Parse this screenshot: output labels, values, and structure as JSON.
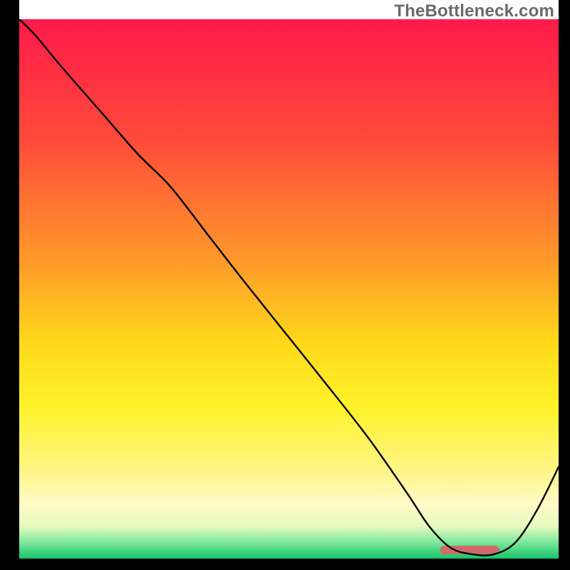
{
  "watermark_text": "TheBottleneck.com",
  "chart_data": {
    "type": "line",
    "title": "",
    "xlabel": "",
    "ylabel": "",
    "xlim": [
      0,
      100
    ],
    "ylim": [
      0,
      100
    ],
    "grid": false,
    "x": [
      0,
      3,
      8,
      15,
      22,
      28,
      35,
      42,
      50,
      58,
      65,
      72,
      76,
      80,
      84,
      88,
      92,
      96,
      100
    ],
    "values": [
      100,
      97,
      91,
      83,
      75,
      69,
      60,
      51,
      41,
      31,
      22,
      12,
      6,
      2,
      0.8,
      0.8,
      3,
      9,
      17
    ],
    "marker": {
      "x_start": 78,
      "x_end": 89,
      "y": 1.6,
      "color": "#d16a6a"
    },
    "gradient_stops": [
      {
        "offset": 0,
        "color": "#ff1a4a"
      },
      {
        "offset": 22,
        "color": "#ff4a3a"
      },
      {
        "offset": 45,
        "color": "#ff9a2a"
      },
      {
        "offset": 60,
        "color": "#ffd91a"
      },
      {
        "offset": 72,
        "color": "#fff22a"
      },
      {
        "offset": 84,
        "color": "#fff68a"
      },
      {
        "offset": 90,
        "color": "#fffbc8"
      },
      {
        "offset": 94,
        "color": "#e8fac0"
      },
      {
        "offset": 97,
        "color": "#7be89a"
      },
      {
        "offset": 100,
        "color": "#18c26a"
      }
    ]
  }
}
